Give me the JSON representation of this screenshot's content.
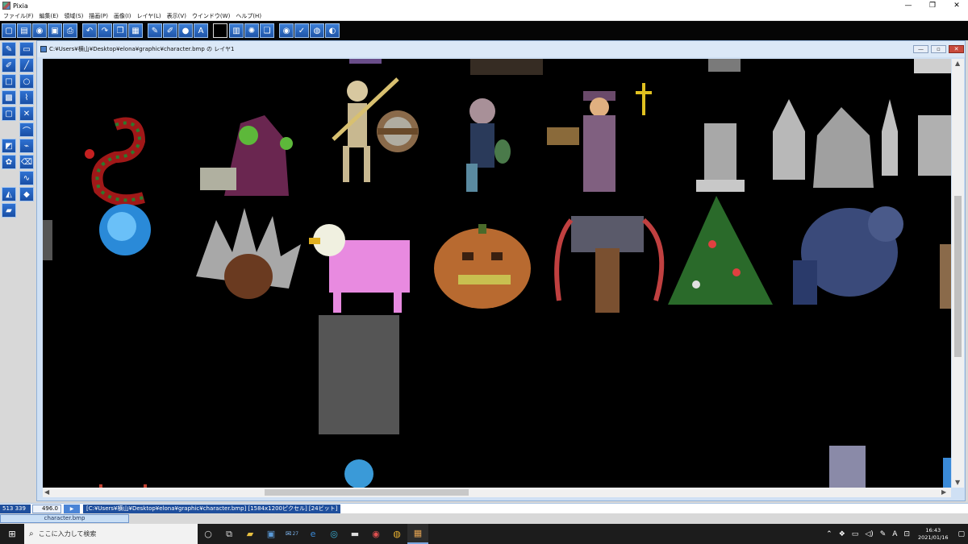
{
  "window": {
    "title": "Pixia",
    "min": "—",
    "max": "❐",
    "close": "✕"
  },
  "menu": [
    "ファイル(F)",
    "編集(E)",
    "領域(S)",
    "描画(P)",
    "画像(I)",
    "レイヤ(L)",
    "表示(V)",
    "ウインドウ(W)",
    "ヘルプ(H)"
  ],
  "document": {
    "title": "C:¥Users¥横山¥Desktop¥elona¥graphic¥character.bmp の レイヤ1"
  },
  "status": {
    "coords": "513 339",
    "zoom": "496.0",
    "play": "▶",
    "info": "[C:¥Users¥横山¥Desktop¥elona¥graphic¥character.bmp] [1584x1200ピクセル] [24ビット]"
  },
  "tabs": [
    {
      "label": "character.bmp"
    }
  ],
  "taskbar": {
    "search_placeholder": "ここに入力して検索",
    "mail_badge": "27",
    "ime": "A",
    "time": "16:43",
    "date": "2021/01/16"
  },
  "colors": {
    "toolbar_button": "#2b66c4",
    "canvas": "#000000",
    "status_accent": "#1f4f9d"
  }
}
